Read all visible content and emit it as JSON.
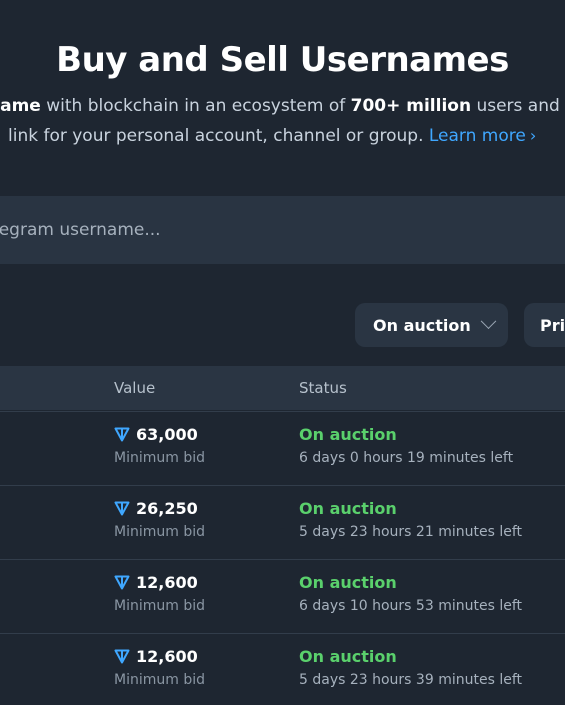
{
  "hero": {
    "title": "Buy and Sell Usernames",
    "line1_a": "name",
    "line1_b": " with blockchain in an ecosystem of ",
    "line1_c": "700+ million",
    "line1_d": " users and a",
    "line2_a": "link for your personal account, channel or group. ",
    "learn_more": "Learn more"
  },
  "search": {
    "placeholder": "legram username..."
  },
  "filters": {
    "status_label": "On auction",
    "price_label": "Pri"
  },
  "table": {
    "columns": [
      "Value",
      "Status"
    ],
    "rows": [
      {
        "value": "63,000",
        "value_label": "Minimum bid",
        "status": "On auction",
        "time_left": "6 days 0 hours 19 minutes left"
      },
      {
        "value": "26,250",
        "value_label": "Minimum bid",
        "status": "On auction",
        "time_left": "5 days 23 hours 21 minutes left"
      },
      {
        "value": "12,600",
        "value_label": "Minimum bid",
        "status": "On auction",
        "time_left": "6 days 10 hours 53 minutes left"
      },
      {
        "value": "12,600",
        "value_label": "Minimum bid",
        "status": "On auction",
        "time_left": "5 days 23 hours 39 minutes left"
      }
    ]
  },
  "colors": {
    "background": "#1e2631",
    "accent_link": "#3fa7ff",
    "status_green": "#5ad06c",
    "ton_icon": "#3fa7ff"
  },
  "icons": {
    "currency": "ton-diamond-icon",
    "dropdown": "chevron-down-icon",
    "link_arrow": "chevron-right-icon"
  }
}
